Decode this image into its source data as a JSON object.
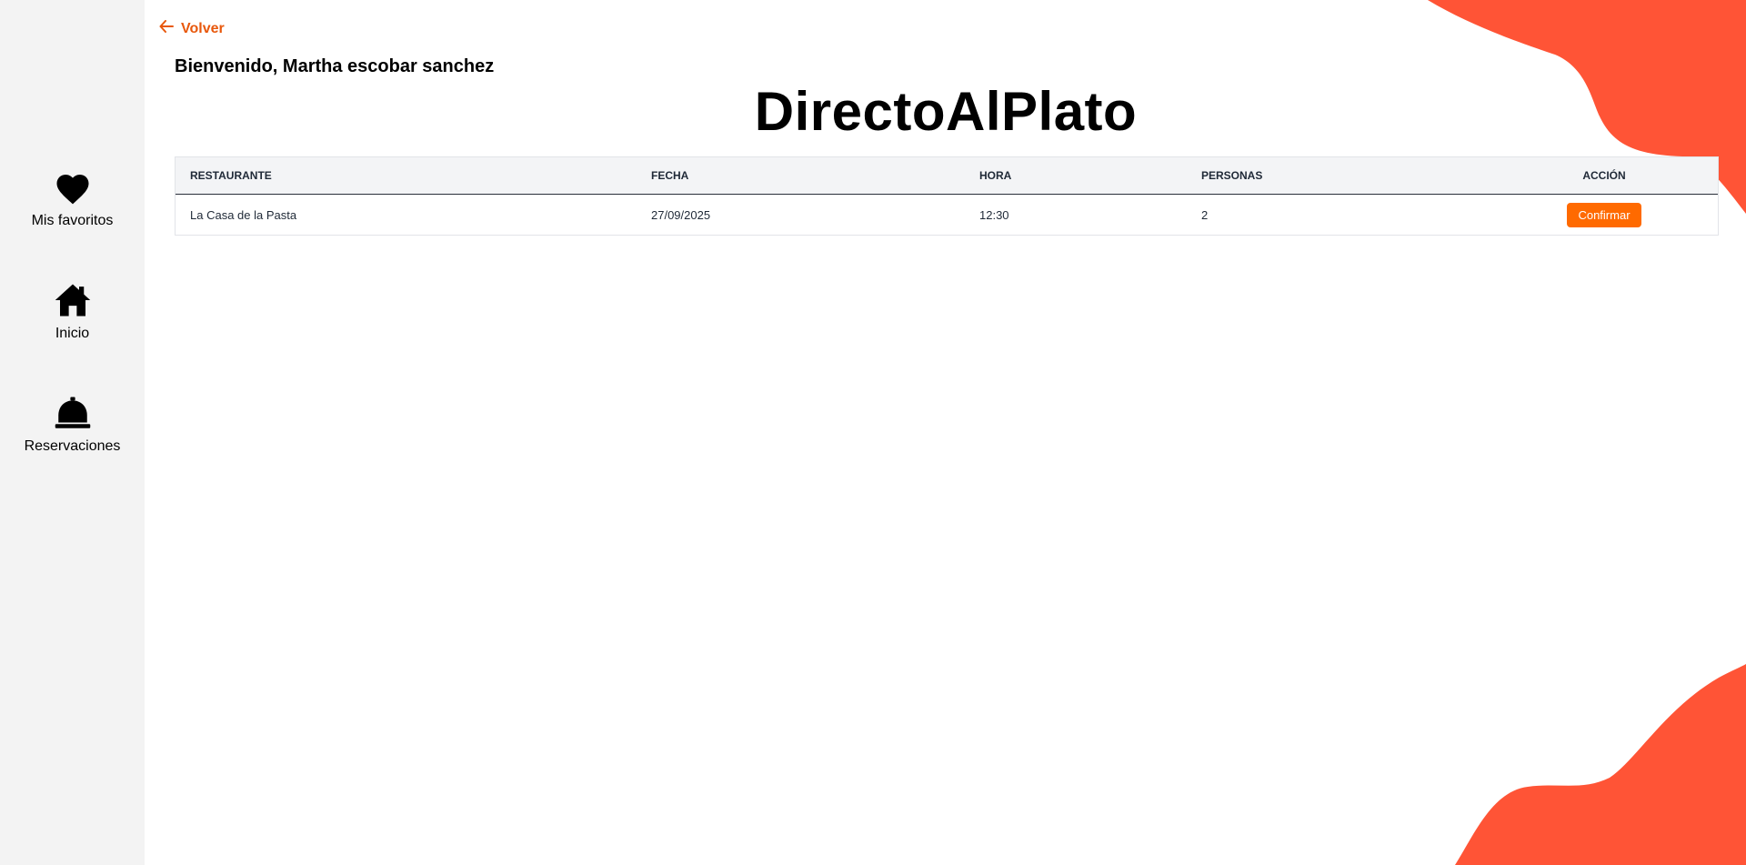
{
  "nav": {
    "back_label": "Volver",
    "items": [
      {
        "label": "Mis favoritos",
        "icon": "heart-icon"
      },
      {
        "label": "Inicio",
        "icon": "home-icon"
      },
      {
        "label": "Reservaciones",
        "icon": "service-bell-icon"
      }
    ]
  },
  "header": {
    "welcome": "Bienvenido, Martha escobar sanchez",
    "brand": "DirectoAlPlato"
  },
  "table": {
    "columns": [
      "RESTAURANTE",
      "FECHA",
      "HORA",
      "PERSONAS",
      "ACCIÓN"
    ],
    "rows": [
      {
        "restaurante": "La Casa de la Pasta",
        "fecha": "27/09/2025",
        "hora": "12:30",
        "personas": "2",
        "accion": "Confirmar"
      }
    ]
  },
  "colors": {
    "accent": "#ff6a00",
    "back_link": "#e8580c",
    "blob": "#ff5436",
    "sidebar_bg": "#f3f3f3"
  }
}
